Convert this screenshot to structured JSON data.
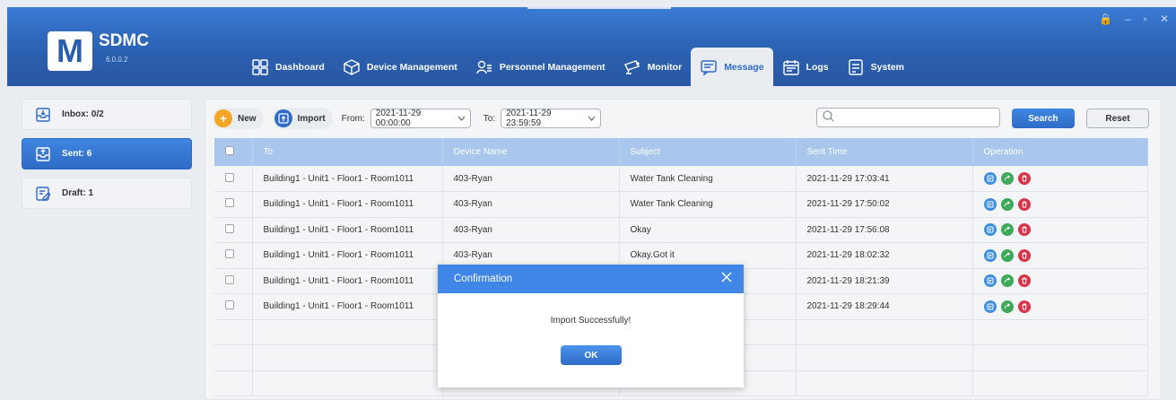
{
  "app": {
    "logo_letter": "M",
    "name": "SDMC",
    "version": "6.0.0.2"
  },
  "window_controls": {
    "lock": "🔒",
    "minimize": "–",
    "restore": "▫",
    "close": "✕"
  },
  "nav": [
    {
      "label": "Dashboard",
      "icon": "dashboard-icon"
    },
    {
      "label": "Device Management",
      "icon": "device-icon"
    },
    {
      "label": "Personnel Management",
      "icon": "personnel-icon"
    },
    {
      "label": "Monitor",
      "icon": "monitor-icon"
    },
    {
      "label": "Message",
      "icon": "message-icon",
      "active": true
    },
    {
      "label": "Logs",
      "icon": "logs-icon"
    },
    {
      "label": "System",
      "icon": "system-icon"
    }
  ],
  "sidebar": {
    "items": [
      {
        "label": "Inbox: 0/2",
        "icon": "inbox-icon"
      },
      {
        "label": "Sent: 6",
        "icon": "sent-icon",
        "active": true
      },
      {
        "label": "Draft: 1",
        "icon": "draft-icon"
      }
    ]
  },
  "toolbar": {
    "new_label": "New",
    "import_label": "Import",
    "from_label": "From:",
    "from_value": "2021-11-29 00:00:00",
    "to_label": "To:",
    "to_value": "2021-11-29 23:59:59",
    "search_value": "",
    "search_label": "Search",
    "reset_label": "Reset"
  },
  "table": {
    "columns": [
      "To",
      "Device Name",
      "Subject",
      "Sent Time",
      "Operation"
    ],
    "rows": [
      {
        "to": "Building1 - Unit1 - Floor1 - Room1011",
        "device": "403-Ryan",
        "subject": "Water Tank Cleaning",
        "time": "2021-11-29 17:03:41"
      },
      {
        "to": "Building1 - Unit1 - Floor1 - Room1011",
        "device": "403-Ryan",
        "subject": "Water Tank Cleaning",
        "time": "2021-11-29 17:50:02"
      },
      {
        "to": "Building1 - Unit1 - Floor1 - Room1011",
        "device": "403-Ryan",
        "subject": "Okay",
        "time": "2021-11-29 17:56:08"
      },
      {
        "to": "Building1 - Unit1 - Floor1 - Room1011",
        "device": "403-Ryan",
        "subject": "Okay.Got it",
        "time": "2021-11-29 18:02:32"
      },
      {
        "to": "Building1 - Unit1 - Floor1 - Room1011",
        "device": "",
        "subject": "",
        "time": "2021-11-29 18:21:39"
      },
      {
        "to": "Building1 - Unit1 - Floor1 - Room1011",
        "device": "",
        "subject": "",
        "time": "2021-11-29 18:29:44"
      }
    ],
    "empty_rows": 3
  },
  "modal": {
    "title": "Confirmation",
    "message": "Import Successfully!",
    "ok_label": "OK"
  },
  "colors": {
    "accent": "#2f6bc6",
    "header": "#2a5fae",
    "op_view": "#3f8fe0",
    "op_forward": "#3daa5a",
    "op_delete": "#d9354a"
  }
}
